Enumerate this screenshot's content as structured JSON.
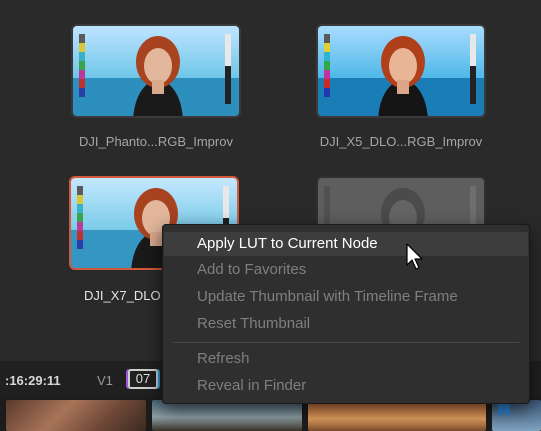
{
  "lut_browser": {
    "thumbnails": [
      {
        "label": "DJI_Phanto...RGB_Improv"
      },
      {
        "label": "DJI_X5_DLO...RGB_Improv"
      },
      {
        "label": "DJI_X7_DLO"
      }
    ]
  },
  "timeline": {
    "timecode": ":16:29:11",
    "track": "V1",
    "clip_number": "07"
  },
  "context_menu": {
    "items": [
      {
        "label": "Apply LUT to Current Node",
        "enabled": true
      },
      {
        "label": "Add to Favorites",
        "enabled": false
      },
      {
        "label": "Update Thumbnail with Timeline Frame",
        "enabled": false
      },
      {
        "label": "Reset Thumbnail",
        "enabled": false
      },
      {
        "label": "Refresh",
        "enabled": false
      },
      {
        "label": "Reveal in Finder",
        "enabled": false
      }
    ]
  },
  "colors": {
    "selection_border": "#d4583a",
    "menu_background": "#2f2f2f"
  },
  "icons": [
    "portrait-thumbnail-icon",
    "bookmark-icon",
    "pointer-cursor-icon"
  ]
}
